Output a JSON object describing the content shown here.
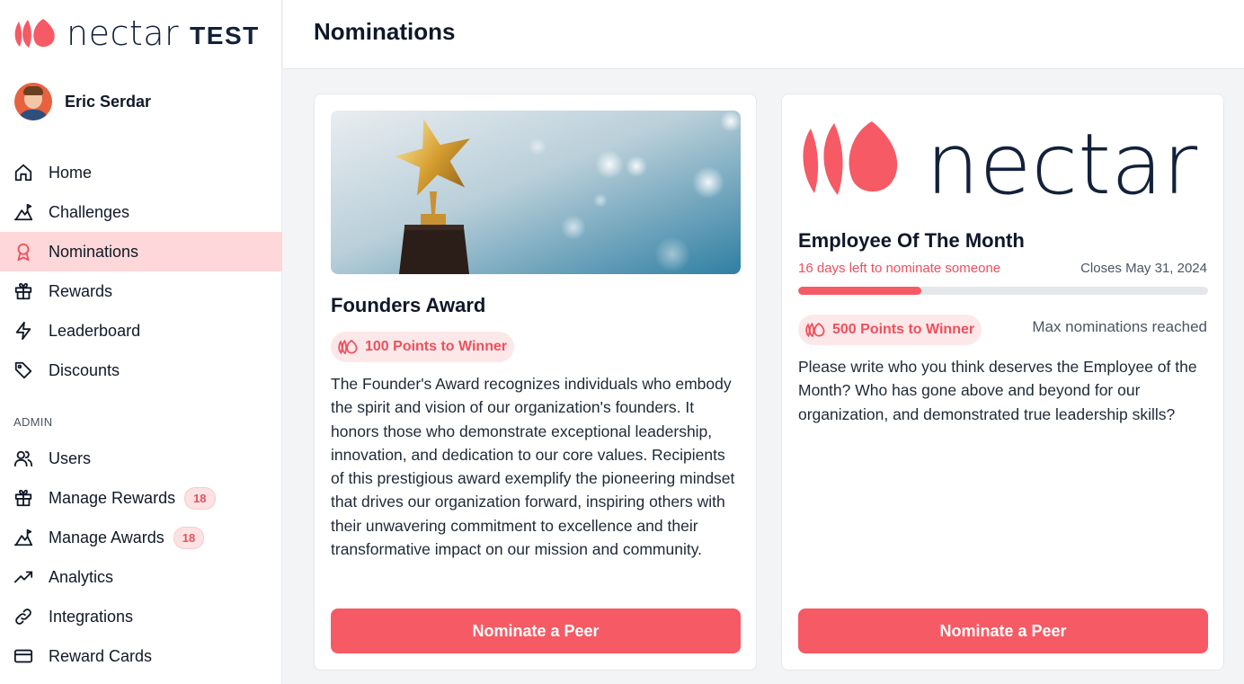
{
  "app": {
    "logo_word": "nectar",
    "env_label": "TEST",
    "brand_color": "#f65a64"
  },
  "user": {
    "name": "Eric Serdar"
  },
  "nav": {
    "items": [
      {
        "label": "Home",
        "icon": "home-icon"
      },
      {
        "label": "Challenges",
        "icon": "mountain-icon"
      },
      {
        "label": "Nominations",
        "icon": "award-icon",
        "active": true
      },
      {
        "label": "Rewards",
        "icon": "gift-icon"
      },
      {
        "label": "Leaderboard",
        "icon": "lightning-icon"
      },
      {
        "label": "Discounts",
        "icon": "tag-icon"
      }
    ],
    "admin_label": "ADMIN",
    "admin_items": [
      {
        "label": "Users",
        "icon": "users-icon"
      },
      {
        "label": "Manage Rewards",
        "icon": "gift-icon",
        "badge": "18"
      },
      {
        "label": "Manage Awards",
        "icon": "mountain-icon",
        "badge": "18"
      },
      {
        "label": "Analytics",
        "icon": "trending-up-icon"
      },
      {
        "label": "Integrations",
        "icon": "link-icon"
      },
      {
        "label": "Reward Cards",
        "icon": "credit-card-icon"
      }
    ]
  },
  "header": {
    "title": "Nominations"
  },
  "cards": [
    {
      "title": "Founders Award",
      "points_label": "100 Points to Winner",
      "description": "The Founder's Award recognizes individuals who embody the spirit and vision of our organization's founders. It honors those who demonstrate exceptional leadership, innovation, and dedication to our core values. Recipients of this prestigious award exemplify the pioneering mindset that drives our organization forward, inspiring others with their unwavering commitment to excellence and their transformative impact on our mission and community.",
      "button_label": "Nominate a Peer"
    },
    {
      "title": "Employee Of The Month",
      "logo_word": "nectar",
      "deadline_text": "16 days left to nominate someone",
      "closes_text": "Closes May 31, 2024",
      "progress_fraction": 0.3,
      "points_label": "500 Points to Winner",
      "status_text": "Max nominations reached",
      "description": "Please write who you think deserves the Employee of the Month? Who has gone above and beyond for our organization, and demonstrated true leadership skills?",
      "button_label": "Nominate a Peer"
    }
  ]
}
